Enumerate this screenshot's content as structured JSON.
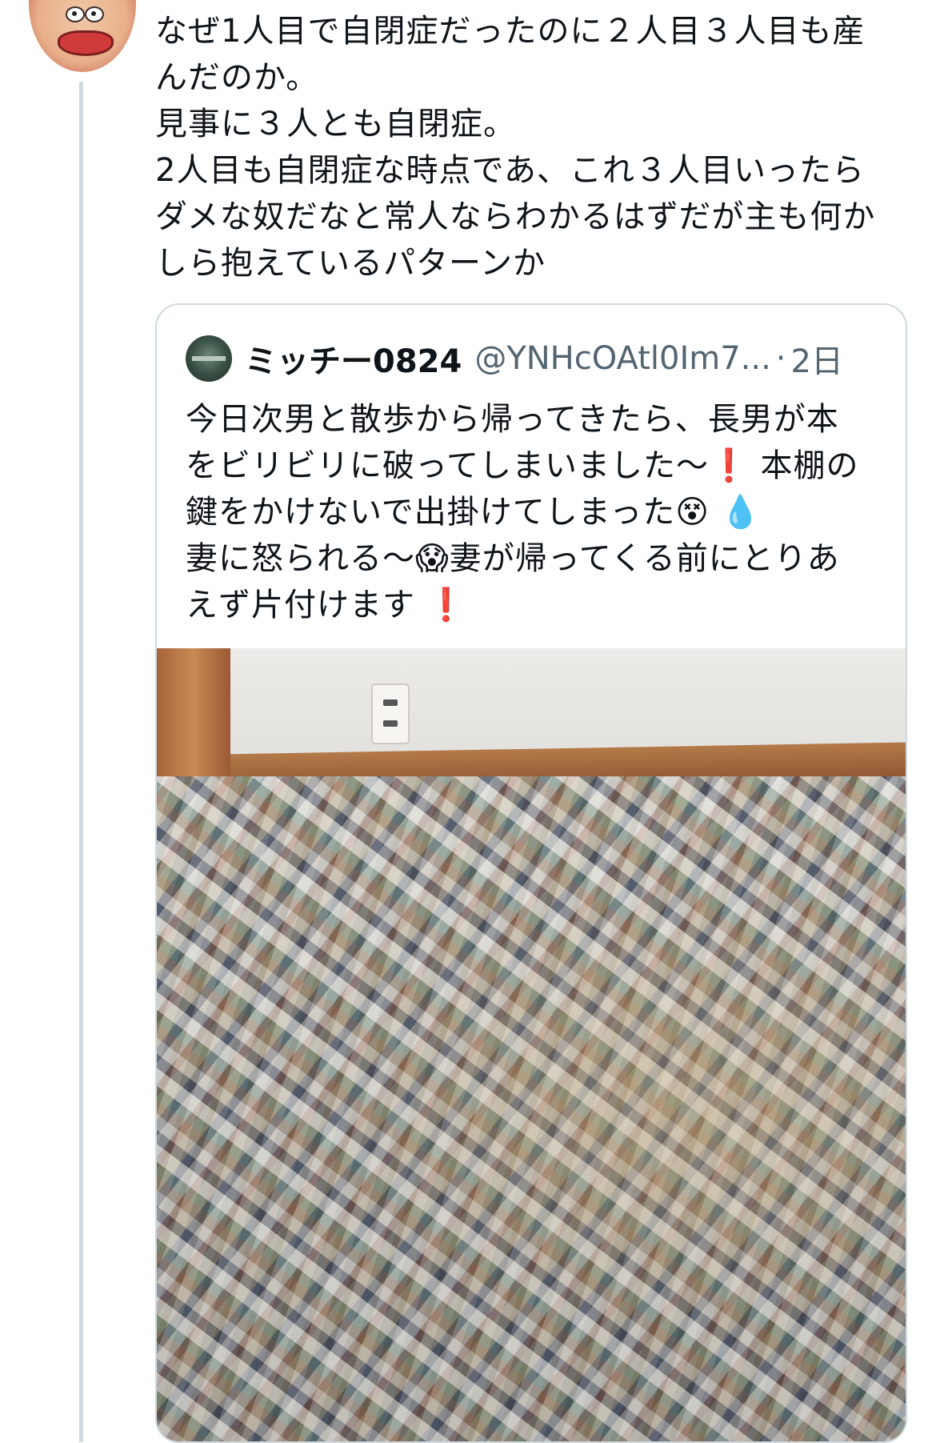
{
  "tweet": {
    "text": "なぜ1人目で自閉症だったのに２人目３人目も産\nんだのか。\n見事に３人とも自閉症。\n2人目も自閉症な時点であ、これ３人目いったら\nダメな奴だなと常人ならわかるはずだが主も何か\nしら抱えているパターンか"
  },
  "quote": {
    "name": "ミッチー0824",
    "handle": "@YNHcOAtl0Im7...",
    "separator": "·",
    "time": "2日",
    "text": "今日次男と散歩から帰ってきたら、長男が本\nをビリビリに破ってしまいました〜❗ 本棚の\n鍵をかけないで出掛けてしまった😵 💧\n妻に怒られる〜😱妻が帰ってくる前にとりあ\nえず片付けます ❗"
  }
}
